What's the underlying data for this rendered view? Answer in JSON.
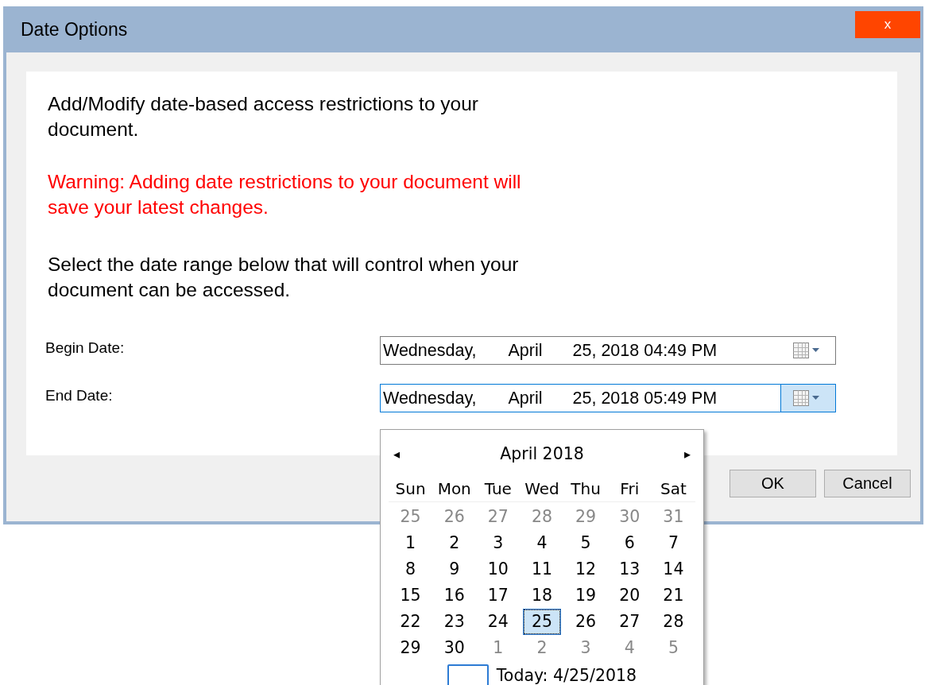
{
  "window": {
    "title": "Date Options",
    "close_label": "x"
  },
  "intro": "Add/Modify date-based access restrictions to your document.",
  "warning": "Warning: Adding date restrictions to your document will save your latest changes.",
  "instruction": "Select the date range below that will control when your document can be accessed.",
  "fields": [
    {
      "label": "Begin Date:",
      "weekday": "Wednesday,",
      "month": "April",
      "rest": "25, 2018 04:49 PM",
      "focused": false
    },
    {
      "label": "End Date:",
      "weekday": "Wednesday,",
      "month": "April",
      "rest": "25, 2018 05:49 PM",
      "focused": true
    }
  ],
  "calendar": {
    "prev": "◂",
    "next": "▸",
    "title": "April 2018",
    "weekdays": [
      "Sun",
      "Mon",
      "Tue",
      "Wed",
      "Thu",
      "Fri",
      "Sat"
    ],
    "weeks": [
      [
        {
          "label": "25",
          "other_month": true,
          "selected": false
        },
        {
          "label": "26",
          "other_month": true,
          "selected": false
        },
        {
          "label": "27",
          "other_month": true,
          "selected": false
        },
        {
          "label": "28",
          "other_month": true,
          "selected": false
        },
        {
          "label": "29",
          "other_month": true,
          "selected": false
        },
        {
          "label": "30",
          "other_month": true,
          "selected": false
        },
        {
          "label": "31",
          "other_month": true,
          "selected": false
        }
      ],
      [
        {
          "label": "1",
          "other_month": false,
          "selected": false
        },
        {
          "label": "2",
          "other_month": false,
          "selected": false
        },
        {
          "label": "3",
          "other_month": false,
          "selected": false
        },
        {
          "label": "4",
          "other_month": false,
          "selected": false
        },
        {
          "label": "5",
          "other_month": false,
          "selected": false
        },
        {
          "label": "6",
          "other_month": false,
          "selected": false
        },
        {
          "label": "7",
          "other_month": false,
          "selected": false
        }
      ],
      [
        {
          "label": "8",
          "other_month": false,
          "selected": false
        },
        {
          "label": "9",
          "other_month": false,
          "selected": false
        },
        {
          "label": "10",
          "other_month": false,
          "selected": false
        },
        {
          "label": "11",
          "other_month": false,
          "selected": false
        },
        {
          "label": "12",
          "other_month": false,
          "selected": false
        },
        {
          "label": "13",
          "other_month": false,
          "selected": false
        },
        {
          "label": "14",
          "other_month": false,
          "selected": false
        }
      ],
      [
        {
          "label": "15",
          "other_month": false,
          "selected": false
        },
        {
          "label": "16",
          "other_month": false,
          "selected": false
        },
        {
          "label": "17",
          "other_month": false,
          "selected": false
        },
        {
          "label": "18",
          "other_month": false,
          "selected": false
        },
        {
          "label": "19",
          "other_month": false,
          "selected": false
        },
        {
          "label": "20",
          "other_month": false,
          "selected": false
        },
        {
          "label": "21",
          "other_month": false,
          "selected": false
        }
      ],
      [
        {
          "label": "22",
          "other_month": false,
          "selected": false
        },
        {
          "label": "23",
          "other_month": false,
          "selected": false
        },
        {
          "label": "24",
          "other_month": false,
          "selected": false
        },
        {
          "label": "25",
          "other_month": false,
          "selected": true
        },
        {
          "label": "26",
          "other_month": false,
          "selected": false
        },
        {
          "label": "27",
          "other_month": false,
          "selected": false
        },
        {
          "label": "28",
          "other_month": false,
          "selected": false
        }
      ],
      [
        {
          "label": "29",
          "other_month": false,
          "selected": false
        },
        {
          "label": "30",
          "other_month": false,
          "selected": false
        },
        {
          "label": "1",
          "other_month": true,
          "selected": false
        },
        {
          "label": "2",
          "other_month": true,
          "selected": false
        },
        {
          "label": "3",
          "other_month": true,
          "selected": false
        },
        {
          "label": "4",
          "other_month": true,
          "selected": false
        },
        {
          "label": "5",
          "other_month": true,
          "selected": false
        }
      ]
    ],
    "today": "Today: 4/25/2018"
  },
  "buttons": [
    "OK",
    "Cancel"
  ]
}
